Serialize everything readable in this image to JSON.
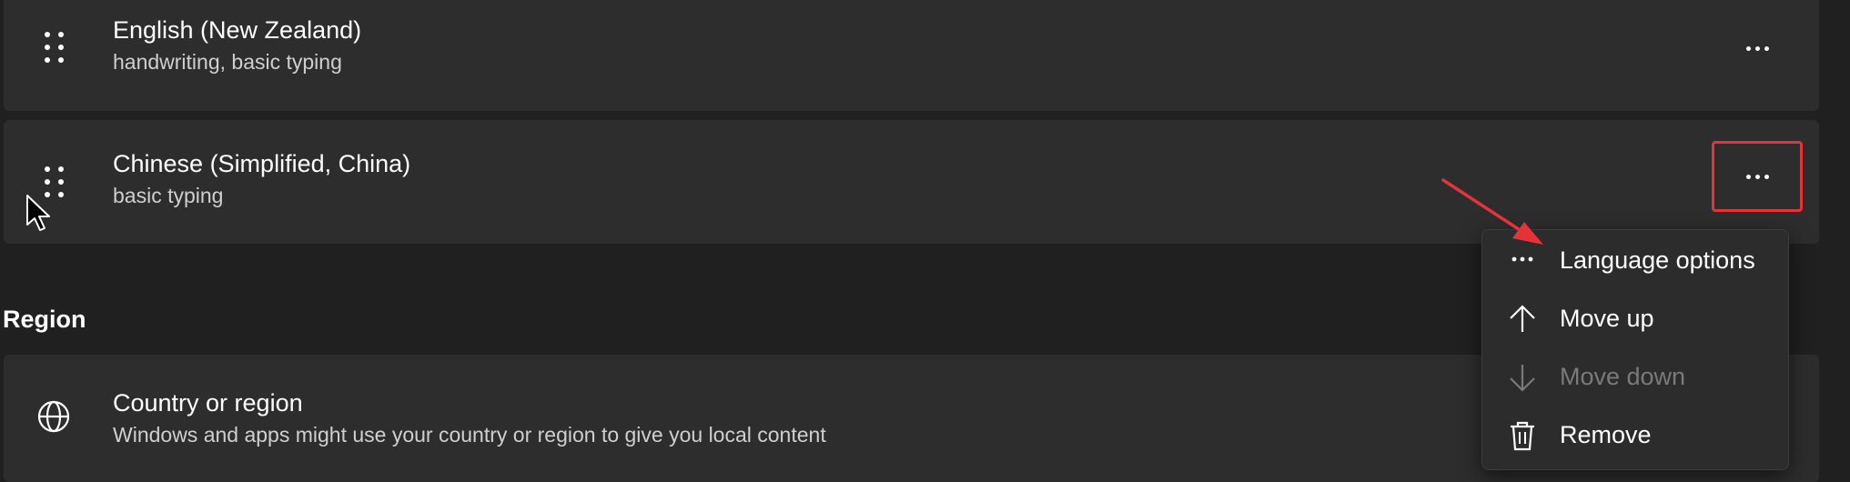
{
  "languages": [
    {
      "name": "English (New Zealand)",
      "features": "handwriting, basic typing"
    },
    {
      "name": "Chinese (Simplified, China)",
      "features": "basic typing"
    }
  ],
  "region": {
    "section_title": "Region",
    "country": {
      "title": "Country or region",
      "description": "Windows and apps might use your country or region to give you local content"
    }
  },
  "context_menu": {
    "items": [
      {
        "label": "Language options",
        "icon": "more-horizontal-icon",
        "enabled": true
      },
      {
        "label": "Move up",
        "icon": "arrow-up-icon",
        "enabled": true
      },
      {
        "label": "Move down",
        "icon": "arrow-down-icon",
        "enabled": false
      },
      {
        "label": "Remove",
        "icon": "trash-icon",
        "enabled": true
      }
    ]
  },
  "annotation": {
    "highlight_color": "#e5333a"
  }
}
